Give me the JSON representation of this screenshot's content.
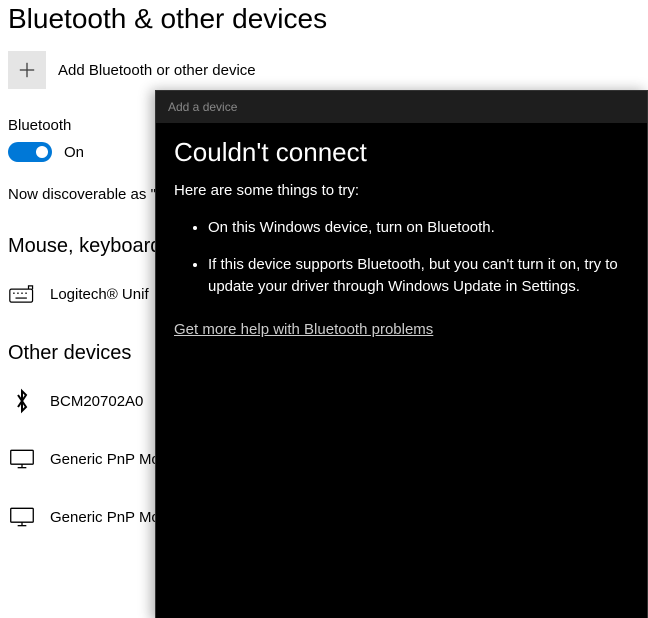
{
  "page": {
    "title": "Bluetooth & other devices",
    "add_label": "Add Bluetooth or other device",
    "bluetooth_label": "Bluetooth",
    "toggle_on": true,
    "toggle_state_label": "On",
    "discoverable_text": "Now discoverable as \""
  },
  "categories": {
    "mkp": "Mouse, keyboard",
    "other": "Other devices"
  },
  "devices": {
    "mkp_0": "Logitech® Unif",
    "other_0": "BCM20702A0",
    "other_1": "Generic PnP Mo",
    "other_2": "Generic PnP Mo"
  },
  "dialog": {
    "title_bar": "Add a device",
    "heading": "Couldn't connect",
    "subheading": "Here are some things to try:",
    "tips": {
      "0": "On this Windows device, turn on Bluetooth.",
      "1": "If this device supports Bluetooth, but you can't turn it on, try to update your driver through Windows Update in Settings."
    },
    "help_link": "Get more help with Bluetooth problems"
  },
  "colors": {
    "accent": "#0078d7",
    "dialog_bg": "#000000"
  }
}
